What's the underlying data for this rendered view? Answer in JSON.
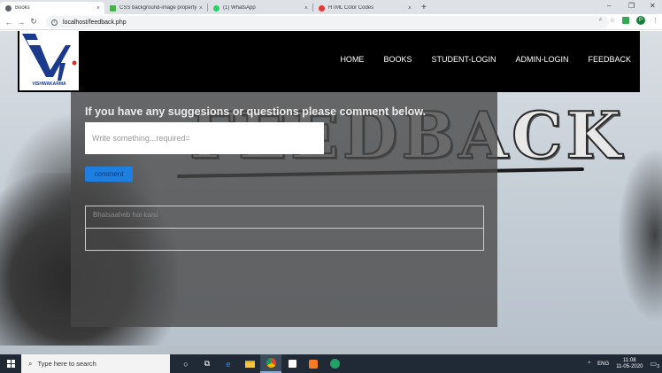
{
  "browser": {
    "tabs": [
      {
        "title": "Books",
        "active": true,
        "favicon_color": "#5f6368"
      },
      {
        "title": "CSS background-image property",
        "active": false,
        "favicon_color": "#4caf50"
      },
      {
        "title": "(1) WhatsApp",
        "active": false,
        "favicon_color": "#25d366"
      },
      {
        "title": "HTML Color Codes",
        "active": false,
        "favicon_color": "#e53935"
      }
    ],
    "close_glyph": "×",
    "new_tab_glyph": "+",
    "window_controls": [
      "–",
      "❐",
      "✕"
    ],
    "url": "localhost/feedback.php",
    "profile_initial": "P"
  },
  "site": {
    "logo_caption": "VISHWAKARMA",
    "nav": [
      "HOME",
      "BOOKS",
      "STUDENT-LOGIN",
      "ADMIN-LOGIN",
      "FEEDBACK"
    ],
    "background_word": "FEEDBACK"
  },
  "feedback": {
    "heading": "If you have any suggesions or questions please comment below.",
    "textarea_placeholder": "Write something...required=",
    "submit_label": "comment",
    "comments_rows": [
      "Bhaisaaheb hai kaisi",
      ""
    ]
  },
  "taskbar": {
    "search_placeholder": "Type here to search",
    "language": "ENG",
    "time": "11:08",
    "date": "11-05-2020",
    "notification_count": "3"
  }
}
